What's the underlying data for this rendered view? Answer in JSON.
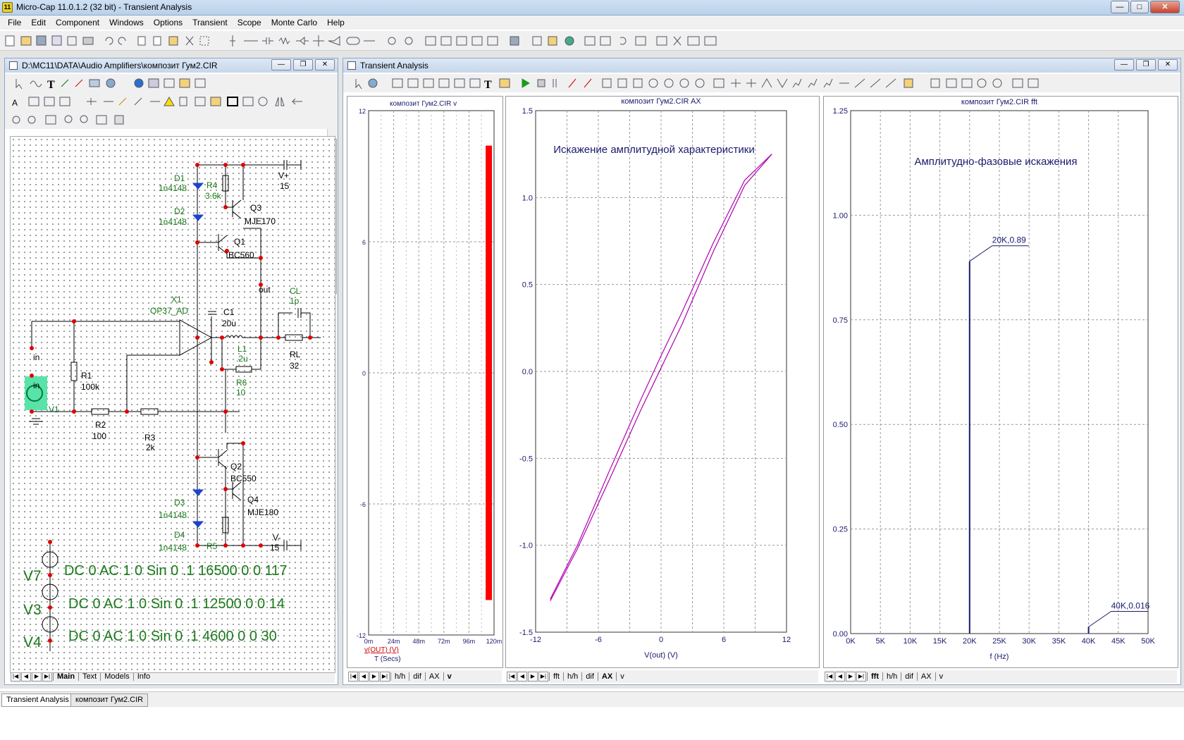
{
  "window": {
    "title": "Micro-Cap 11.0.1.2 (32 bit) - Transient Analysis"
  },
  "menu": [
    "File",
    "Edit",
    "Component",
    "Windows",
    "Options",
    "Transient",
    "Scope",
    "Monte Carlo",
    "Help"
  ],
  "schematic_window": {
    "title": "D:\\MC11\\DATA\\Audio Amplifiers\\композит Гум2.CIR",
    "labels": {
      "d1": "D1",
      "d1_model": "1n4148",
      "d2": "D2",
      "d2_model": "1n4148",
      "d3": "D3",
      "d3_model": "1n4148",
      "d4": "D4",
      "d4_model": "1n4148",
      "r4": "R4",
      "r4_val": "3.6k",
      "r5": "R5",
      "q3": "Q3",
      "q3_model": "MJE170",
      "q1": "Q1",
      "q1_model": "BC560",
      "q2": "Q2",
      "q2_model": "BC550",
      "q4": "Q4",
      "q4_model": "MJE180",
      "vplus": "V+",
      "vplus_val": "15",
      "vminus": "V-",
      "vminus_val": "15",
      "out": "out",
      "cl": "CL",
      "cl_val": "1p",
      "x1": "X1",
      "x1_model": "OP37_AD",
      "c1": "C1",
      "c1_val": "20u",
      "l1": "L1",
      "l1_val": ".2u",
      "rl": "RL",
      "rl_val": "32",
      "r6": "R6",
      "r6_val": "10",
      "in1": "in",
      "in2": "in",
      "r1": "R1",
      "r1_val": "100k",
      "v1": "V1",
      "r2": "R2",
      "r2_val": "100",
      "r3": "R3",
      "r3_val": "2k",
      "v7": "V7",
      "v7_spec": "DC 0 AC 1 0 Sin 0 .1 16500 0 0 117",
      "v3": "V3",
      "v3_spec": "DC 0 AC 1 0 Sin 0 .1 12500 0 0 14",
      "v4": "V4",
      "v4_spec": "DC 0 AC 1 0 Sin 0 .1 4600 0 0 30"
    },
    "tabs": [
      "Main",
      "Text",
      "Models",
      "Info"
    ]
  },
  "analysis_window": {
    "title": "Transient Analysis"
  },
  "plot_v": {
    "title": "композит Гум2.CIR v",
    "trace_label": "v(OUT) (V)",
    "xlabel": "T (Secs)",
    "tabs": [
      "h/h",
      "dif",
      "AX",
      "v"
    ]
  },
  "plot_ax": {
    "tabs": [
      "fft",
      "h/h",
      "dif",
      "AX",
      "v"
    ]
  },
  "plot_fft": {
    "tabs": [
      "fft",
      "h/h",
      "dif",
      "AX",
      "v"
    ]
  },
  "chart_data": [
    {
      "type": "line",
      "title": "композит Гум2.CIR v",
      "xlabel": "T (Secs)",
      "ylabel": "v(OUT) (V)",
      "x_ticks": [
        "0m",
        "24m",
        "48m",
        "72m",
        "96m",
        "120m"
      ],
      "y_ticks": [
        "-12",
        "-6",
        "0",
        "6",
        "12"
      ],
      "xlim": [
        0,
        120
      ],
      "ylim": [
        -12,
        12
      ],
      "band": {
        "x": [
          112,
          118
        ],
        "y": [
          -10.4,
          10.4
        ],
        "color": "#ff0000"
      },
      "grid": true
    },
    {
      "type": "line",
      "title": "композит Гум2.CIR AX",
      "annotation": "Искажение амплитудной характеристики",
      "xlabel": "V(out) (V)",
      "x_ticks": [
        "-12",
        "-6",
        "0",
        "6",
        "12"
      ],
      "y_ticks": [
        "-1.5",
        "-1.0",
        "-0.5",
        "0.0",
        "0.5",
        "1.0",
        "1.5"
      ],
      "xlim": [
        -12,
        12
      ],
      "ylim": [
        -1.5,
        1.5
      ],
      "series": [
        {
          "x": [
            -10.6,
            -8,
            -5,
            -2,
            0,
            2,
            5,
            8,
            10.6
          ],
          "y": [
            -1.32,
            -1.02,
            -0.63,
            -0.23,
            0.02,
            0.27,
            0.69,
            1.07,
            1.25
          ]
        },
        {
          "x": [
            -10.6,
            -8,
            -5,
            -2,
            0,
            2,
            5,
            8,
            10.6
          ],
          "y": [
            -1.31,
            -1.0,
            -0.58,
            -0.17,
            0.09,
            0.34,
            0.74,
            1.1,
            1.25
          ]
        }
      ],
      "color": "#b000b0",
      "grid": true
    },
    {
      "type": "bar",
      "title": "композит Гум2.CIR fft",
      "annotation": "Амплитудно-фазовые искажения",
      "xlabel": "f (Hz)",
      "x_ticks": [
        "0K",
        "5K",
        "10K",
        "15K",
        "20K",
        "25K",
        "30K",
        "35K",
        "40K",
        "45K",
        "50K"
      ],
      "y_ticks": [
        "0.00",
        "0.25",
        "0.50",
        "0.75",
        "1.00",
        "1.25"
      ],
      "xlim": [
        0,
        50000
      ],
      "ylim": [
        0,
        1.25
      ],
      "peaks": [
        {
          "x": 20000,
          "y": 0.89,
          "label": "20K,0.89"
        },
        {
          "x": 40000,
          "y": 0.016,
          "label": "40K,0.016"
        }
      ],
      "color": "#1a1a6e",
      "grid": true
    }
  ],
  "status_tabs": [
    "Transient Analysis",
    "композит Гум2.CIR"
  ]
}
